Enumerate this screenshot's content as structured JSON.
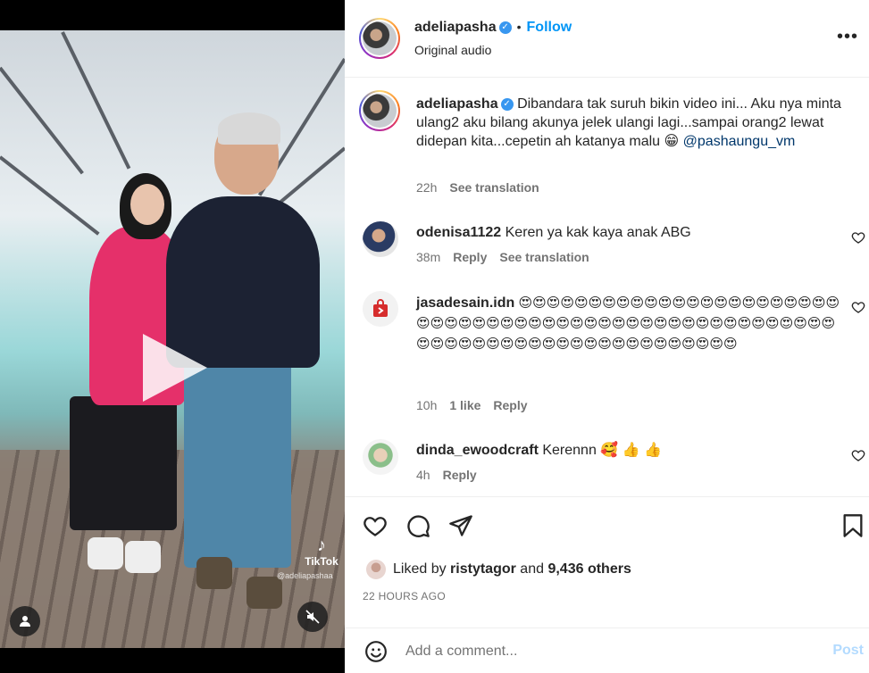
{
  "post": {
    "username": "adeliapasha",
    "follow_label": "Follow",
    "audio_label": "Original audio",
    "video_watermark": "TikTok",
    "video_watermark_handle": "@adeliapashaa"
  },
  "caption": {
    "username": "adeliapasha",
    "text": "Dibandara tak suruh bikin video ini... Aku nya minta ulang2 aku bilang akunya jelek ulangi lagi...sampai orang2 lewat didepan kita...cepetin ah katanya malu 😁",
    "mention": "@pashaungu_vm",
    "time": "22h",
    "see_translation": "See translation"
  },
  "comments": [
    {
      "username": "odenisa1122",
      "text": "Keren ya kak kaya anak ABG",
      "time": "38m",
      "reply": "Reply",
      "see_translation": "See translation"
    },
    {
      "username": "jasadesain.idn",
      "text": "😍😍😍😍😍😍😍😍😍😍😍😍😍😍😍😍😍😍😍😍😍😍😍😍😍😍😍😍😍😍😍😍😍😍😍😍😍😍😍😍😍😍😍😍😍😍😍😍😍😍😍😍😍😍😍😍😍😍😍😍😍😍😍😍😍😍😍😍😍😍😍😍😍😍😍😍",
      "time": "10h",
      "likes": "1 like",
      "reply": "Reply"
    },
    {
      "username": "dinda_ewoodcraft",
      "text": "Kerennn 🥰 👍 👍",
      "time": "4h",
      "reply": "Reply"
    }
  ],
  "engagement": {
    "liked_by_prefix": "Liked by",
    "liked_by_user": "ristytagor",
    "and": "and",
    "others": "9,436 others",
    "timestamp": "22 HOURS AGO"
  },
  "composer": {
    "placeholder": "Add a comment...",
    "post_label": "Post"
  },
  "colors": {
    "accent": "#0095f6",
    "verified": "#3897f0",
    "post_disabled": "#b3dbff"
  }
}
